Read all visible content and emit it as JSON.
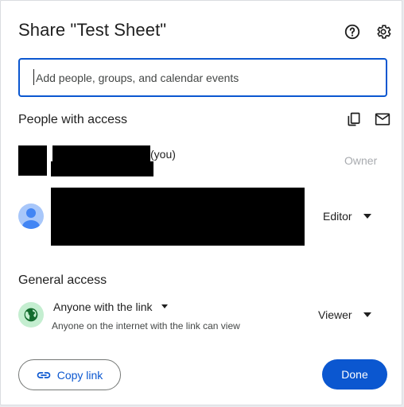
{
  "dialog": {
    "title": "Share \"Test Sheet\"",
    "help_icon": "help-circle-icon",
    "settings_icon": "gear-icon"
  },
  "search": {
    "placeholder": "Add people, groups, and calendar events"
  },
  "people": {
    "section_title": "People with access",
    "copy_icon": "copy-icon",
    "email_icon": "mail-icon",
    "owner": {
      "suffix": "(you)",
      "role": "Owner"
    },
    "editor": {
      "role": "Editor"
    }
  },
  "general_access": {
    "section_title": "General access",
    "link_setting": "Anyone with the link",
    "description": "Anyone on the internet with the link can view",
    "role": "Viewer"
  },
  "footer": {
    "copy_link_label": "Copy link",
    "done_label": "Done"
  },
  "colors": {
    "accent": "#0b57d0",
    "globe_bg": "#c4eed0",
    "globe_fg": "#146c2e",
    "avatar_bg": "#a8c7fa",
    "avatar_fg": "#4285f4"
  }
}
